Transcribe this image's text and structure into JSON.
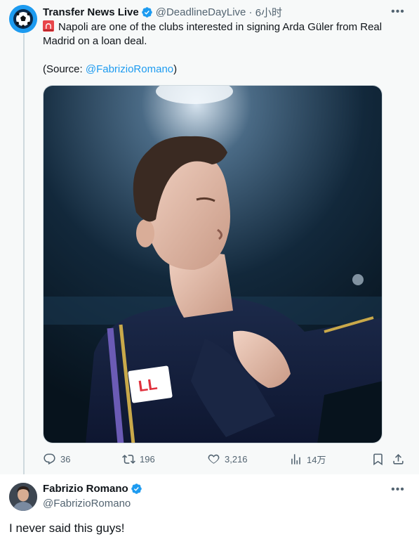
{
  "tweet": {
    "author_name": "Transfer News Live",
    "handle": "@DeadlineDayLive",
    "separator": "·",
    "time": "6小时",
    "text": "Napoli are one of the clubs interested in signing Arda Güler from Real Madrid on a loan deal.",
    "source_prefix": "(Source: ",
    "source_link": "@FabrizioRomano",
    "source_suffix": ")",
    "image_alt": "Arda Güler in Real Madrid navy kit, eyes closed, hand on chest",
    "stats": {
      "replies": "36",
      "retweets": "196",
      "likes": "3,216",
      "views": "14万"
    }
  },
  "reply": {
    "author_name": "Fabrizio Romano",
    "handle": "@FabrizioRomano",
    "text": "I never said this guys!"
  },
  "colors": {
    "accent": "#1d9bf0",
    "muted": "#536471",
    "text": "#0f1419",
    "thread_bg": "#f7f9f9"
  },
  "icons": [
    "siren-icon",
    "verified-icon",
    "more-icon",
    "reply-icon",
    "retweet-icon",
    "like-icon",
    "views-icon",
    "bookmark-icon",
    "share-icon"
  ]
}
